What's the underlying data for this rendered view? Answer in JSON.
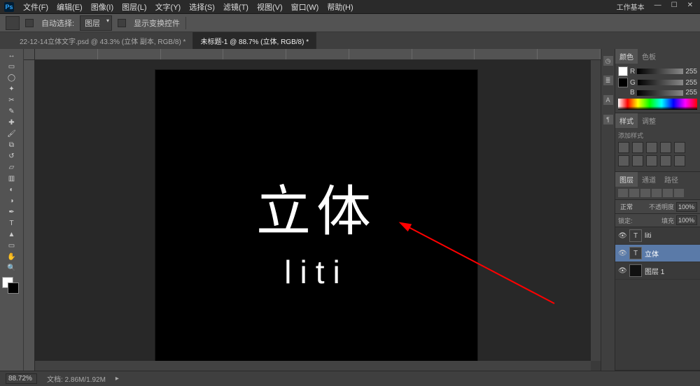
{
  "app": {
    "ps": "Ps"
  },
  "menu": {
    "file": "文件(F)",
    "edit": "编辑(E)",
    "image": "图像(I)",
    "layer": "图层(L)",
    "text": "文字(Y)",
    "select": "选择(S)",
    "filter": "滤镜(T)",
    "view": "视图(V)",
    "window": "窗口(W)",
    "help": "帮助(H)"
  },
  "win_ctrl": {
    "wrk": "工作基本"
  },
  "options": {
    "auto_select": "自动选择:",
    "group": "图层",
    "show_transform": "显示变换控件"
  },
  "tabs": {
    "t1": "22-12-14立体文字.psd @ 43.3% (立体 副本, RGB/8) *",
    "t2": "未标题-1 @ 88.7% (立体, RGB/8) *"
  },
  "canvas_text": {
    "line1": "立体",
    "line2": "liti"
  },
  "panels": {
    "color_tab": "颜色",
    "swatches_tab": "色板",
    "r": "R",
    "g": "G",
    "b": "B",
    "val": "255",
    "styles_tab": "样式",
    "adjust_tab": "调整",
    "add_style": "添加样式",
    "layers_tab": "图层",
    "channels_tab": "通道",
    "paths_tab": "路径",
    "normal": "正常",
    "opacity_lbl": "不透明度",
    "opacity_val": "100%",
    "lock_lbl": "锁定:",
    "fill_lbl": "填充",
    "fill_val": "100%",
    "layer_liti_name": "liti",
    "layer_main": "立体",
    "layer_bg": "图层 1"
  },
  "status": {
    "zoom": "88.72%",
    "doc": "文档: 2.86M/1.92M"
  }
}
